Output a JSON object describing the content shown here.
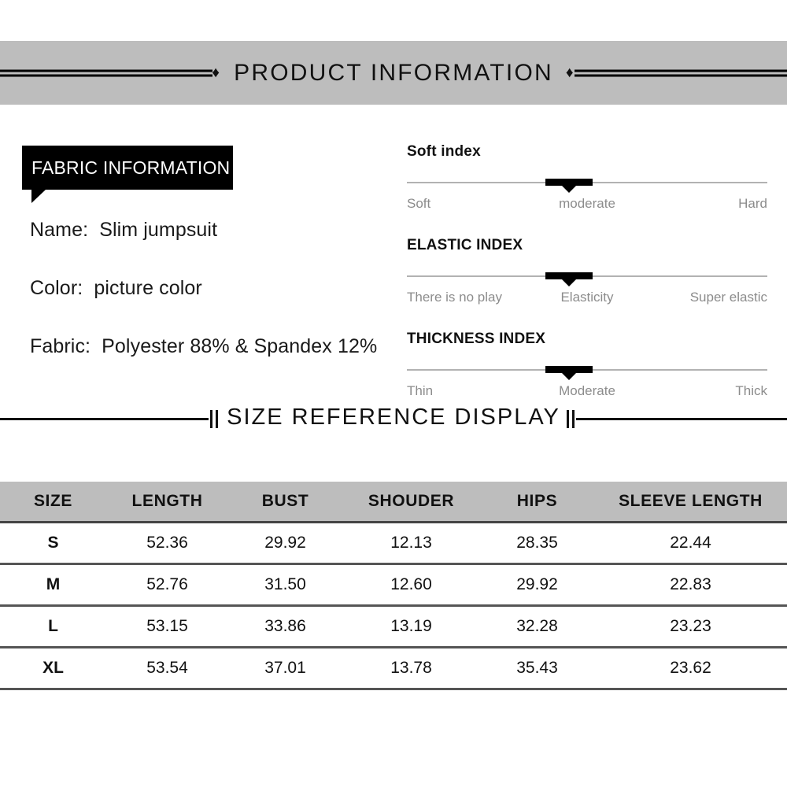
{
  "banner": {
    "title": "PRODUCT INFORMATION",
    "diamond_glyph": "♦",
    "background_color": "#bdbdbd"
  },
  "fabric": {
    "badge_label": "FABRIC INFORMATION",
    "rows": [
      {
        "label": "Name:",
        "value": "Slim jumpsuit"
      },
      {
        "label": "Color:",
        "value": "picture color"
      },
      {
        "label": "Fabric:",
        "value": "Polyester 88% & Spandex 12%"
      }
    ]
  },
  "indexes": [
    {
      "title": "Soft index",
      "low_label": "Soft",
      "mid_label": "moderate",
      "high_label": "Hard",
      "marker_percent": 45
    },
    {
      "title": "ELASTIC INDEX",
      "low_label": "There is no play",
      "mid_label": "Elasticity",
      "high_label": "Super elastic",
      "marker_percent": 45
    },
    {
      "title": "THICKNESS INDEX",
      "low_label": "Thin",
      "mid_label": "Moderate",
      "high_label": "Thick",
      "marker_percent": 45
    }
  ],
  "size_section": {
    "divider_title": "SIZE REFERENCE DISPLAY",
    "headers": [
      "SIZE",
      "LENGTH",
      "BUST",
      "SHOUDER",
      "HIPS",
      "SLEEVE LENGTH"
    ],
    "rows": [
      {
        "size": "S",
        "length": "52.36",
        "bust": "29.92",
        "shoulder": "12.13",
        "hips": "28.35",
        "sleeve": "22.44"
      },
      {
        "size": "M",
        "length": "52.76",
        "bust": "31.50",
        "shoulder": "12.60",
        "hips": "29.92",
        "sleeve": "22.83"
      },
      {
        "size": "L",
        "length": "53.15",
        "bust": "33.86",
        "shoulder": "13.19",
        "hips": "32.28",
        "sleeve": "23.23"
      },
      {
        "size": "XL",
        "length": "53.54",
        "bust": "37.01",
        "shoulder": "13.78",
        "hips": "35.43",
        "sleeve": "23.62"
      }
    ]
  }
}
